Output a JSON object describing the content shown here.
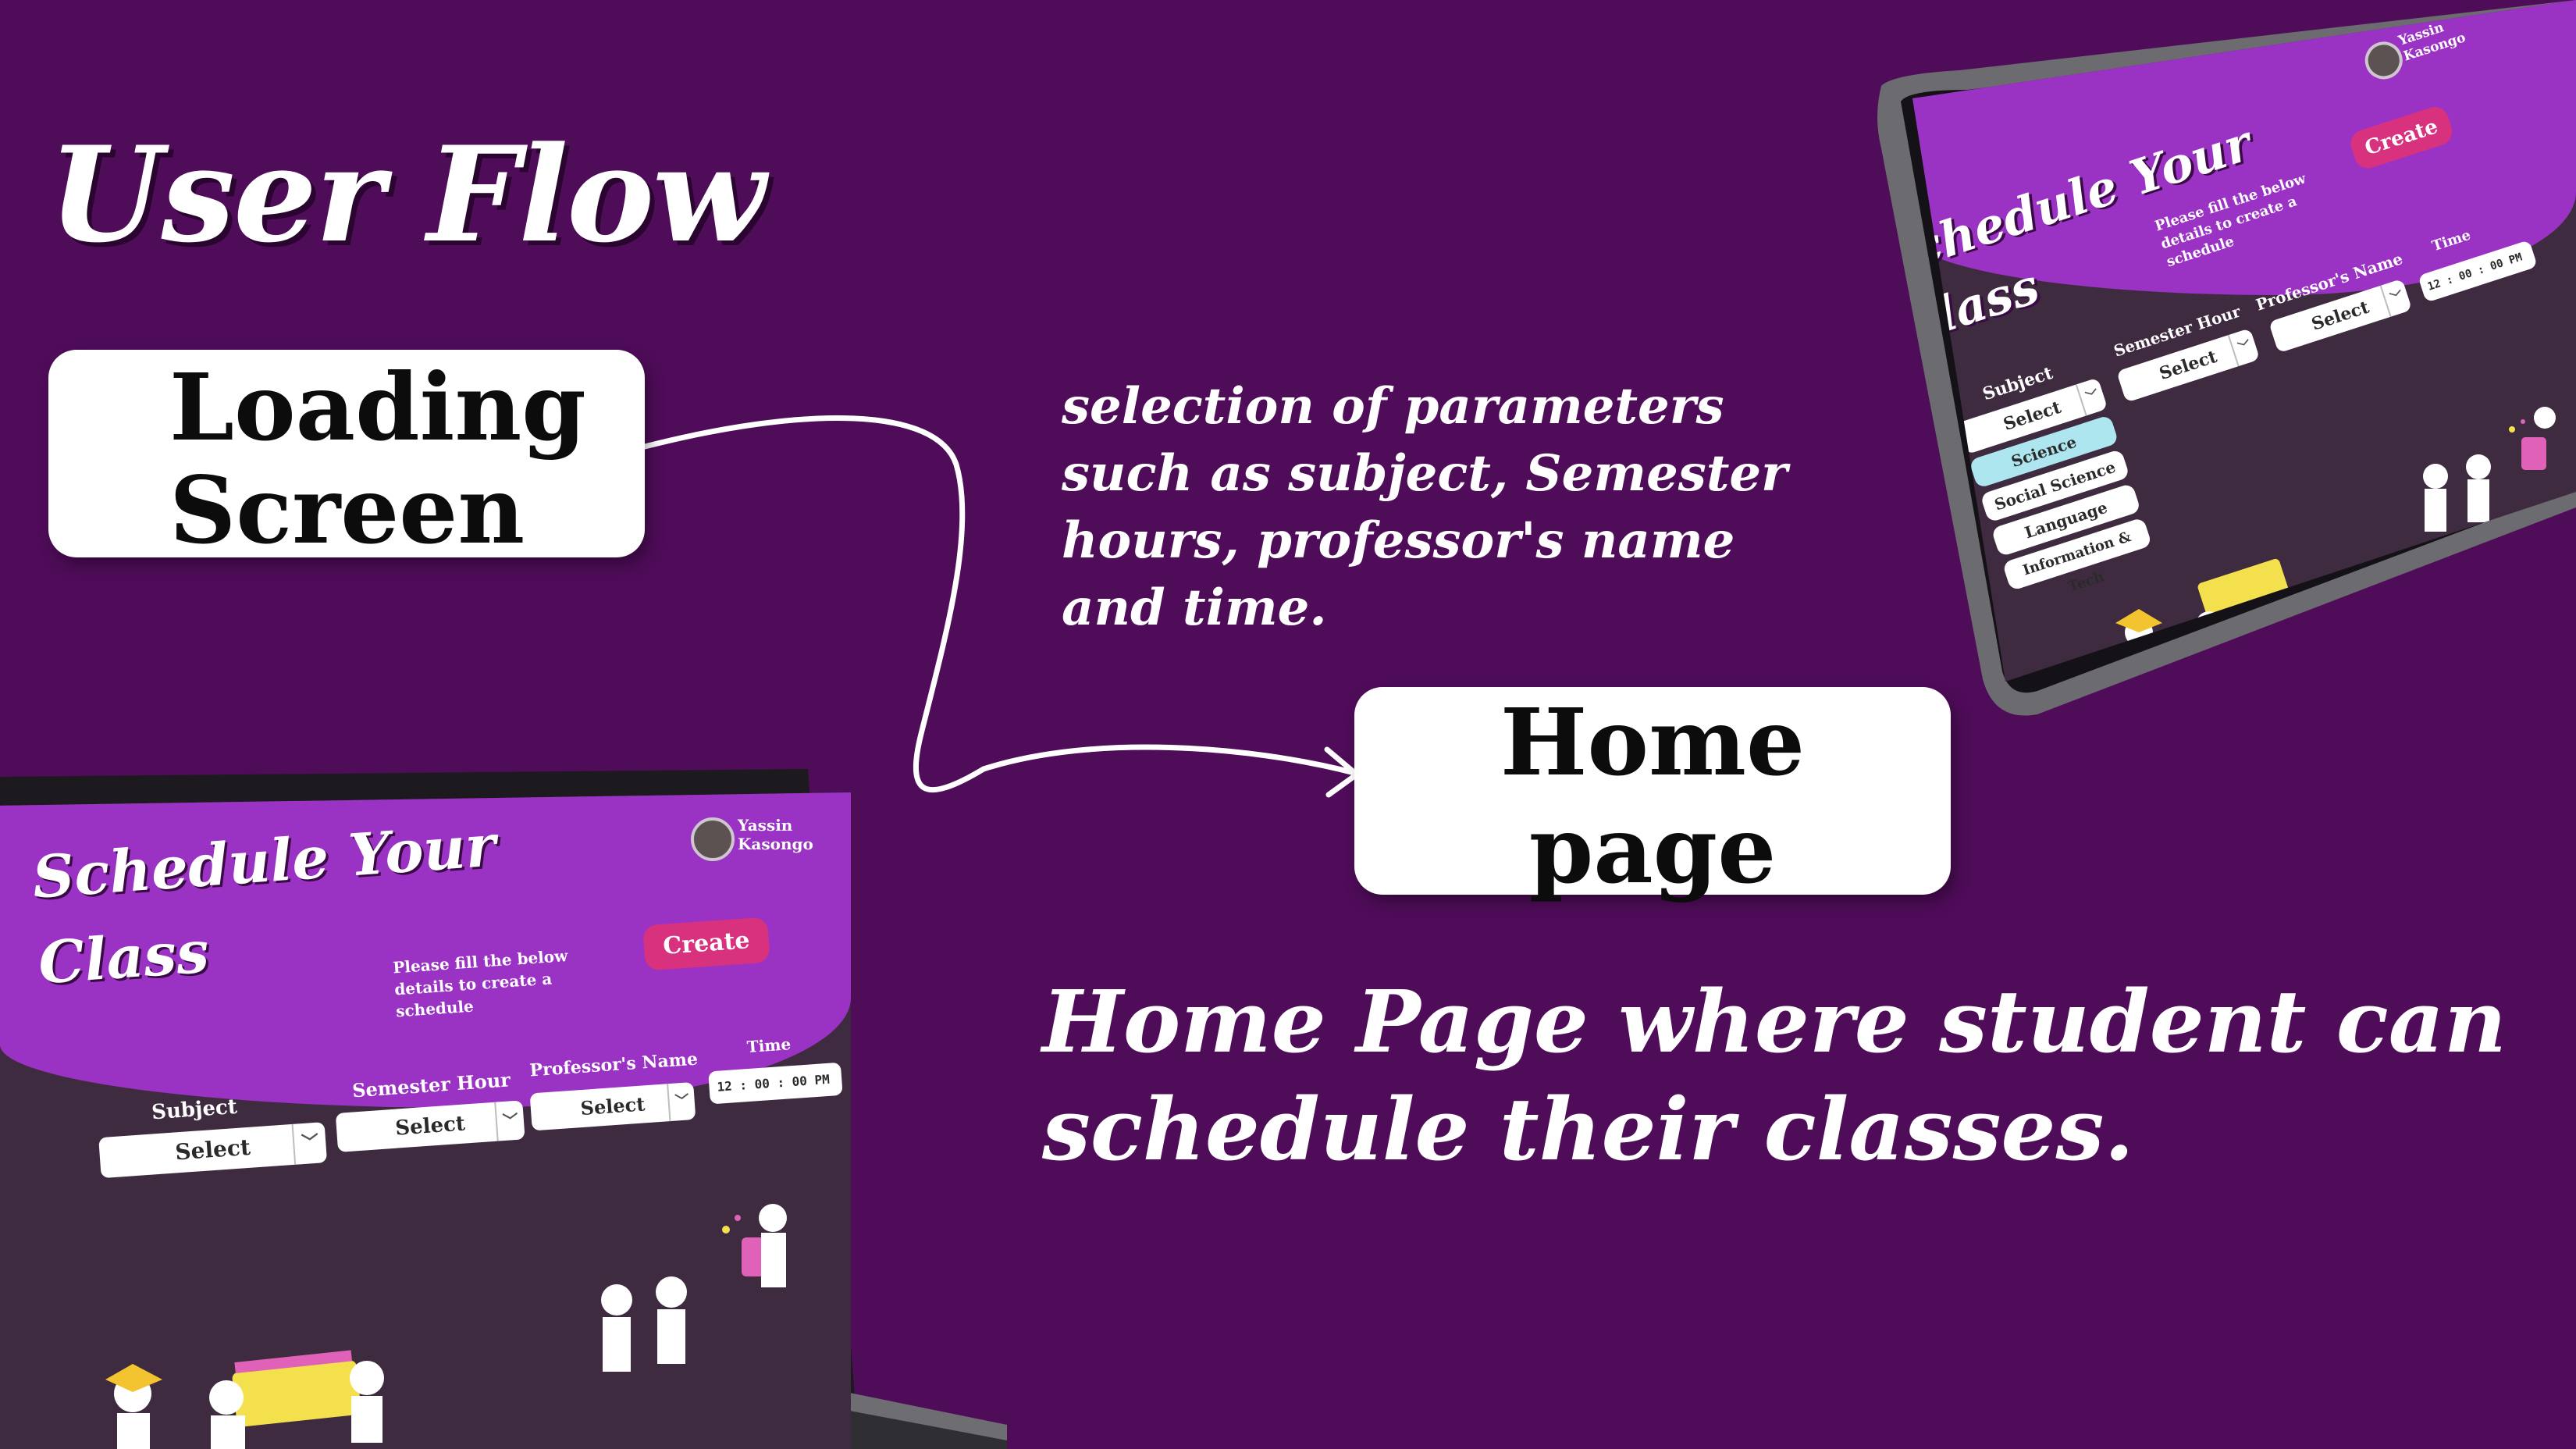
{
  "title": "User Flow",
  "flow": {
    "step1_lines": [
      "Loading",
      "Screen"
    ],
    "step2_lines": [
      "Home",
      "page"
    ],
    "params_note": "selection of parameters such as subject, Semester hours, professor's name and time.",
    "home_note": "Home Page where student can schedule their classes."
  },
  "app": {
    "title_line1": "Schedule Your",
    "title_line2": "Class",
    "hint": "Please fill the below details to create a schedule",
    "create_label": "Create",
    "user_first": "Yassin",
    "user_last": "Kasongo",
    "fields": [
      {
        "label": "Subject",
        "value": "Select"
      },
      {
        "label": "Semester Hour",
        "value": "Select"
      },
      {
        "label": "Professor's Name",
        "value": "Select"
      },
      {
        "label": "Time",
        "hour": "12",
        "minute": "00",
        "second": "00",
        "ampm": "PM"
      }
    ],
    "subject_options": [
      "Science",
      "Social Science",
      "Language",
      "Information & Tech"
    ],
    "caret_symbol": "﹀"
  },
  "colors": {
    "background": "#4f0c59",
    "header_purple": "#9a32c4",
    "screen_dark": "#3f2b3f",
    "create_pink": "#d8327f",
    "highlight_option": "#aee6f0"
  }
}
